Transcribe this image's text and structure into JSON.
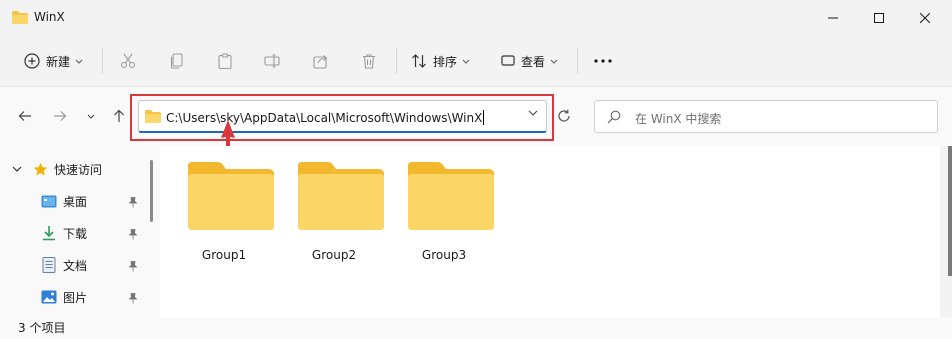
{
  "window": {
    "title": "WinX"
  },
  "command_bar": {
    "new_label": "新建",
    "sort_label": "排序",
    "view_label": "查看",
    "more_label": "···"
  },
  "address_bar": {
    "path": "C:\\Users\\sky\\AppData\\Local\\Microsoft\\Windows\\WinX"
  },
  "search": {
    "placeholder": "在 WinX 中搜索"
  },
  "sidebar": {
    "quick_access_label": "快速访问",
    "items": [
      {
        "label": "桌面",
        "icon": "desktop-icon",
        "pinned": true
      },
      {
        "label": "下载",
        "icon": "download-icon",
        "pinned": true
      },
      {
        "label": "文档",
        "icon": "document-icon",
        "pinned": true
      },
      {
        "label": "图片",
        "icon": "picture-icon",
        "pinned": true
      }
    ]
  },
  "folders": [
    {
      "name": "Group1"
    },
    {
      "name": "Group2"
    },
    {
      "name": "Group3"
    }
  ],
  "status": {
    "item_count": "3 个项目"
  },
  "colors": {
    "highlight_frame": "#d9363e",
    "folder_yellow": "#f8cd53",
    "accent_blue": "#1a66c0"
  }
}
